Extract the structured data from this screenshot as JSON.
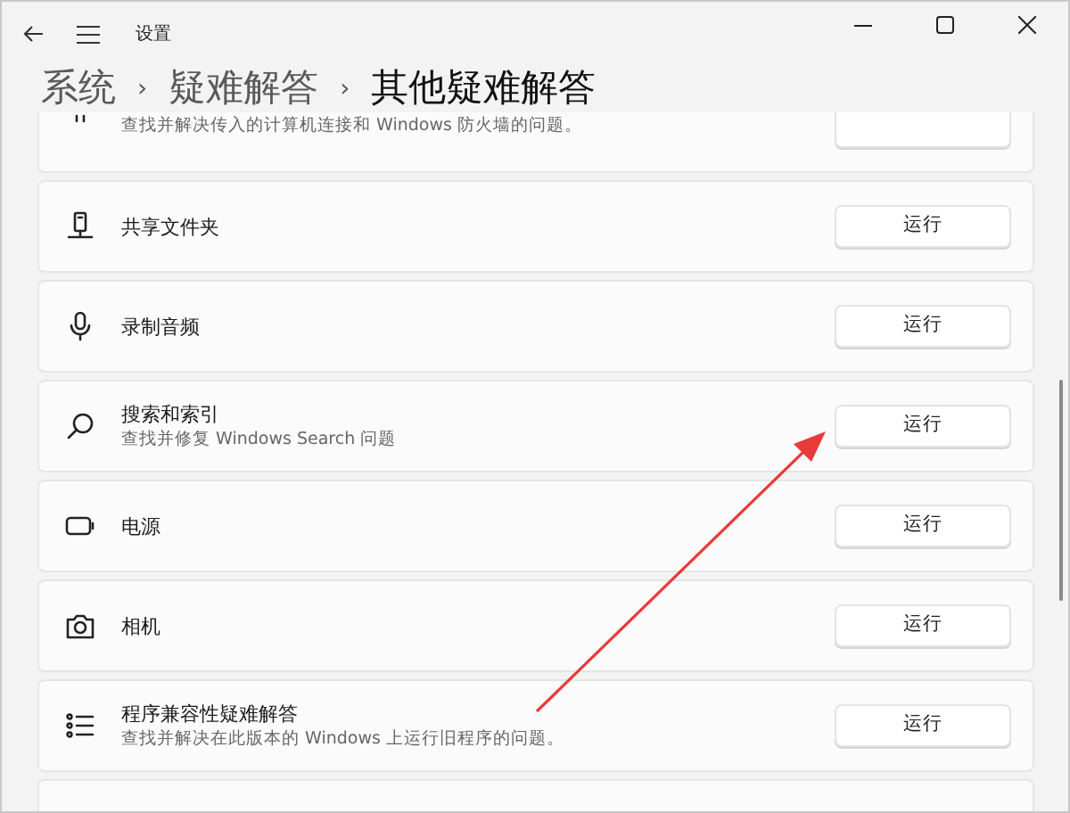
{
  "window": {
    "title": "设置"
  },
  "breadcrumb": [
    {
      "label": "系统",
      "current": false
    },
    {
      "label": "疑难解答",
      "current": false
    },
    {
      "label": "其他疑难解答",
      "current": true
    }
  ],
  "separator": "›",
  "items": [
    {
      "kind": "cut_top",
      "description": "查找并解决传入的计算机连接和 Windows 防火墙的问题。"
    },
    {
      "kind": "full",
      "title": "共享文件夹",
      "button": "运行"
    },
    {
      "kind": "full",
      "title": "录制音频",
      "button": "运行"
    },
    {
      "kind": "full",
      "title": "搜索和索引",
      "description": "查找并修复 Windows Search 问题",
      "button": "运行"
    },
    {
      "kind": "full",
      "title": "电源",
      "button": "运行"
    },
    {
      "kind": "full",
      "title": "相机",
      "button": "运行"
    },
    {
      "kind": "full",
      "title": "程序兼容性疑难解答",
      "description": "查找并解决在此版本的 Windows 上运行旧程序的问题。",
      "button": "运行"
    },
    {
      "kind": "cut_bottom"
    }
  ]
}
